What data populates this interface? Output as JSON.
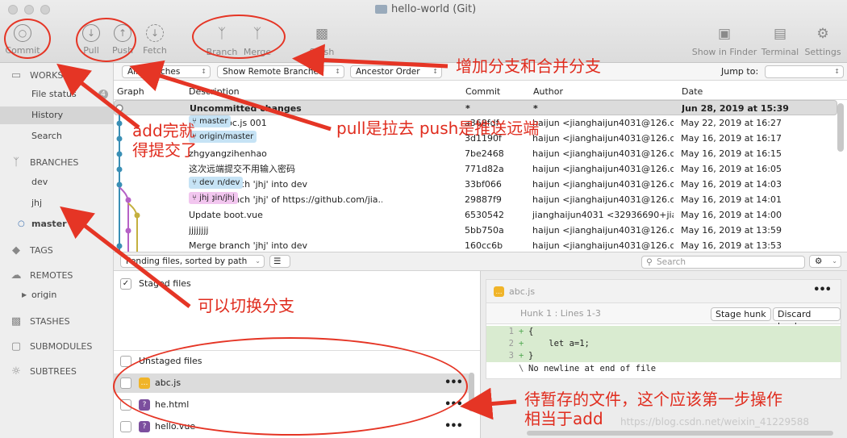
{
  "window": {
    "title": "hello-world (Git)"
  },
  "toolbar": {
    "commit": "Commit",
    "pull": "Pull",
    "push": "Push",
    "fetch": "Fetch",
    "branch": "Branch",
    "merge": "Merge",
    "stash": "Stash",
    "finder": "Show in Finder",
    "terminal": "Terminal",
    "settings": "Settings"
  },
  "filterbar": {
    "branches": "All Branches",
    "remote": "Show Remote Branches",
    "order": "Ancestor Order",
    "jump_label": "Jump to:"
  },
  "sidebar": {
    "workspace": "WORKSPACE",
    "file_status": "File status",
    "file_status_badge": "4",
    "history": "History",
    "search": "Search",
    "branches": "BRANCHES",
    "branch_items": [
      "dev",
      "jhj",
      "master"
    ],
    "tags": "TAGS",
    "remotes": "REMOTES",
    "remote_items": [
      "origin"
    ],
    "stashes": "STASHES",
    "submodules": "SUBMODULES",
    "subtrees": "SUBTREES"
  },
  "history": {
    "columns": {
      "graph": "Graph",
      "description": "Description",
      "commit": "Commit",
      "author": "Author",
      "date": "Date"
    },
    "rows": [
      {
        "desc": "Uncommitted changes",
        "commit": "*",
        "author": "*",
        "date": "Jun 28, 2019 at 15:39"
      },
      {
        "tags": [
          "master"
        ],
        "desc": "sand a abc.js 001",
        "commit": "a368fdf",
        "author": "haijun <jianghaijun4031@126.c...",
        "date": "May 22, 2019 at 16:27"
      },
      {
        "tags": [
          "origin/master"
        ],
        "desc": "delete vue",
        "commit": "3d1190f",
        "author": "haijun <jianghaijun4031@126.c...",
        "date": "May 16, 2019 at 16:17"
      },
      {
        "desc": "zhgyangzihenhao",
        "commit": "7be2468",
        "author": "haijun <jianghaijun4031@126.c...",
        "date": "May 16, 2019 at 16:15"
      },
      {
        "desc": "这次远端提交不用输入密码",
        "commit": "771d82a",
        "author": "haijun <jianghaijun4031@126.c...",
        "date": "May 16, 2019 at 16:05"
      },
      {
        "tags": [
          "origin/dev",
          "dev"
        ],
        "desc": "Merge branch 'jhj' into dev",
        "commit": "33bf066",
        "author": "haijun <jianghaijun4031@126.c...",
        "date": "May 16, 2019 at 14:03"
      },
      {
        "tags": [
          "origin/jhj",
          "jhj"
        ],
        "desc": "Merge branch 'jhj' of https://github.com/jia...",
        "commit": "29887f9",
        "author": "haijun <jianghaijun4031@126.c...",
        "date": "May 16, 2019 at 14:01"
      },
      {
        "desc": "Update boot.vue",
        "commit": "6530542",
        "author": "jianghaijun4031 <32936690+jia...",
        "date": "May 16, 2019 at 14:00"
      },
      {
        "desc": "jjjjjjjj",
        "commit": "5bb750a",
        "author": "haijun <jianghaijun4031@126.c...",
        "date": "May 16, 2019 at 13:59"
      },
      {
        "desc": "Merge branch 'jhj' into dev",
        "commit": "160cc6b",
        "author": "haijun <jianghaijun4031@126.c...",
        "date": "May 16, 2019 at 13:53"
      }
    ]
  },
  "staging": {
    "mode": "Pending files, sorted by path",
    "search_placeholder": "Search",
    "staged_label": "Staged files",
    "unstaged_label": "Unstaged files",
    "files": [
      {
        "name": "abc.js",
        "type": "js"
      },
      {
        "name": "he.html",
        "type": "unknown"
      },
      {
        "name": "hello.vue",
        "type": "unknown"
      }
    ]
  },
  "diff": {
    "file": "abc.js",
    "hunk": "Hunk 1 : Lines 1-3",
    "stage_hunk": "Stage hunk",
    "discard_hunk": "Discard hunk",
    "lines": [
      {
        "num": "1",
        "mark": "+",
        "text": "{"
      },
      {
        "num": "2",
        "mark": "+",
        "text": "    let a=1;"
      },
      {
        "num": "3",
        "mark": "+",
        "text": "}"
      },
      {
        "num": "",
        "mark": "\\",
        "text": "No newline at end of file"
      }
    ]
  },
  "annotations": {
    "branch_merge": "增加分支和合并分支",
    "add_commit": "add完就\n得提交了",
    "pull_push": "pull是拉去 push是推送远端",
    "switch_branch": "可以切换分支",
    "pending": "待暂存的文件，这个应该第一步操作\n相当于add"
  },
  "watermark": "https://blog.csdn.net/weixin_41229588",
  "colors": {
    "annotation": "#e02c1e",
    "graph_blue": "#3a8fb5",
    "graph_purple": "#b561c6",
    "graph_olive": "#c4b03e"
  }
}
